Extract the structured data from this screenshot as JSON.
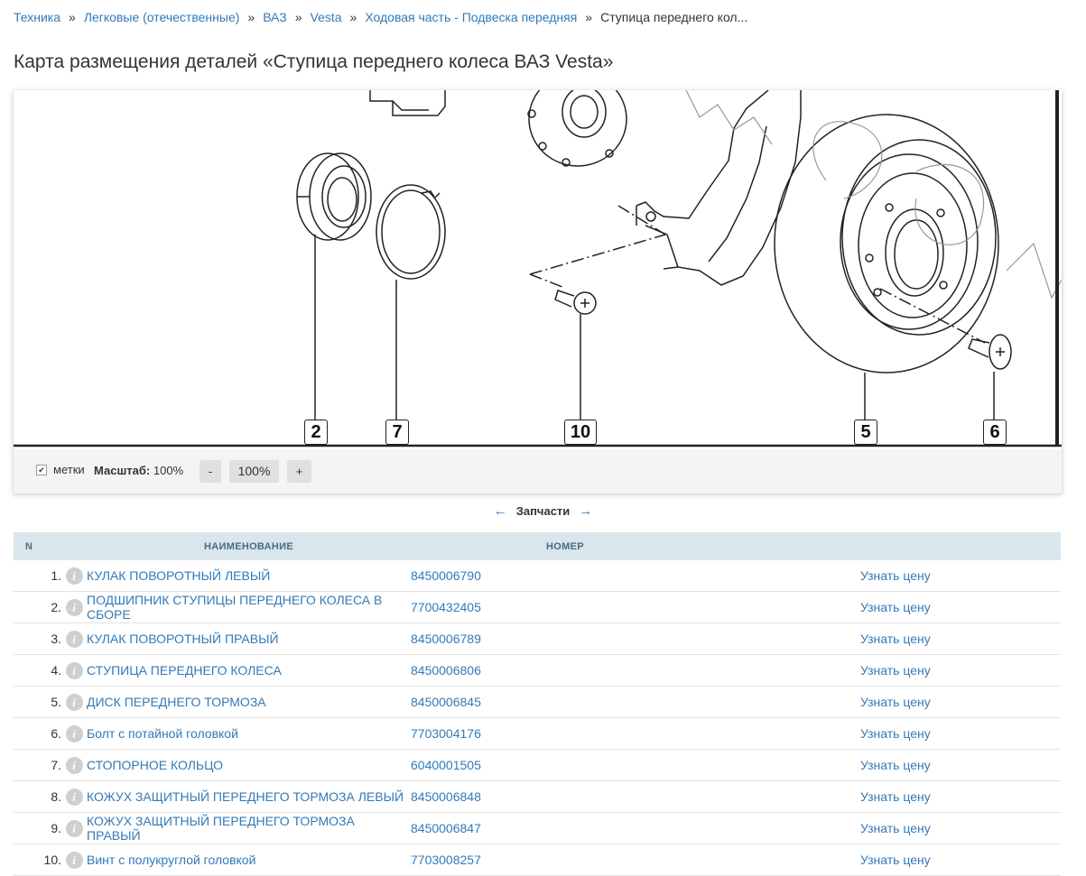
{
  "breadcrumb": {
    "items": [
      "Техника",
      "Легковые (отечественные)",
      "ВАЗ",
      "Vesta",
      "Ходовая часть - Подвеска передняя"
    ],
    "current": "Ступица переднего кол...",
    "separator": "»"
  },
  "page_title": "Карта размещения деталей «Ступица переднего колеса ВАЗ Vesta»",
  "diagram": {
    "callouts": [
      "2",
      "7",
      "10",
      "5",
      "6"
    ]
  },
  "controls": {
    "marks_label": "метки",
    "marks_checked": true,
    "scale_label": "Масштаб:",
    "scale_value": "100%",
    "minus_label": "-",
    "zoom_label": "100%",
    "plus_label": "+"
  },
  "parts_nav": {
    "prev": "←",
    "label": "Запчасти",
    "next": "→"
  },
  "table": {
    "headers": {
      "n": "N",
      "name": "НАИМЕНОВАНИЕ",
      "code": "НОМЕР"
    },
    "rows": [
      {
        "n": "1.",
        "name": "КУЛАК ПОВОРОТНЫЙ ЛЕВЫЙ",
        "code": "8450006790",
        "price": "Узнать цену"
      },
      {
        "n": "2.",
        "name": "ПОДШИПНИК СТУПИЦЫ ПЕРЕДНЕГО КОЛЕСА В СБОРЕ",
        "code": "7700432405",
        "price": "Узнать цену"
      },
      {
        "n": "3.",
        "name": "КУЛАК ПОВОРОТНЫЙ ПРАВЫЙ",
        "code": "8450006789",
        "price": "Узнать цену"
      },
      {
        "n": "4.",
        "name": "СТУПИЦА ПЕРЕДНЕГО КОЛЕСА",
        "code": "8450006806",
        "price": "Узнать цену"
      },
      {
        "n": "5.",
        "name": "ДИСК ПЕРЕДНЕГО ТОРМОЗА",
        "code": "8450006845",
        "price": "Узнать цену"
      },
      {
        "n": "6.",
        "name": "Болт с потайной головкой",
        "code": "7703004176",
        "price": "Узнать цену"
      },
      {
        "n": "7.",
        "name": "СТОПОРНОЕ КОЛЬЦО",
        "code": "6040001505",
        "price": "Узнать цену"
      },
      {
        "n": "8.",
        "name": "КОЖУХ ЗАЩИТНЫЙ ПЕРЕДНЕГО ТОРМОЗА ЛЕВЫЙ",
        "code": "8450006848",
        "price": "Узнать цену"
      },
      {
        "n": "9.",
        "name": "КОЖУХ ЗАЩИТНЫЙ ПЕРЕДНЕГО ТОРМОЗА ПРАВЫЙ",
        "code": "8450006847",
        "price": "Узнать цену"
      },
      {
        "n": "10.",
        "name": "Винт с полукруглой головкой",
        "code": "7703008257",
        "price": "Узнать цену"
      }
    ]
  },
  "colors": {
    "link": "#337ab7",
    "header_bg": "#d9e6ec",
    "info_icon": "#cfcfcf"
  }
}
